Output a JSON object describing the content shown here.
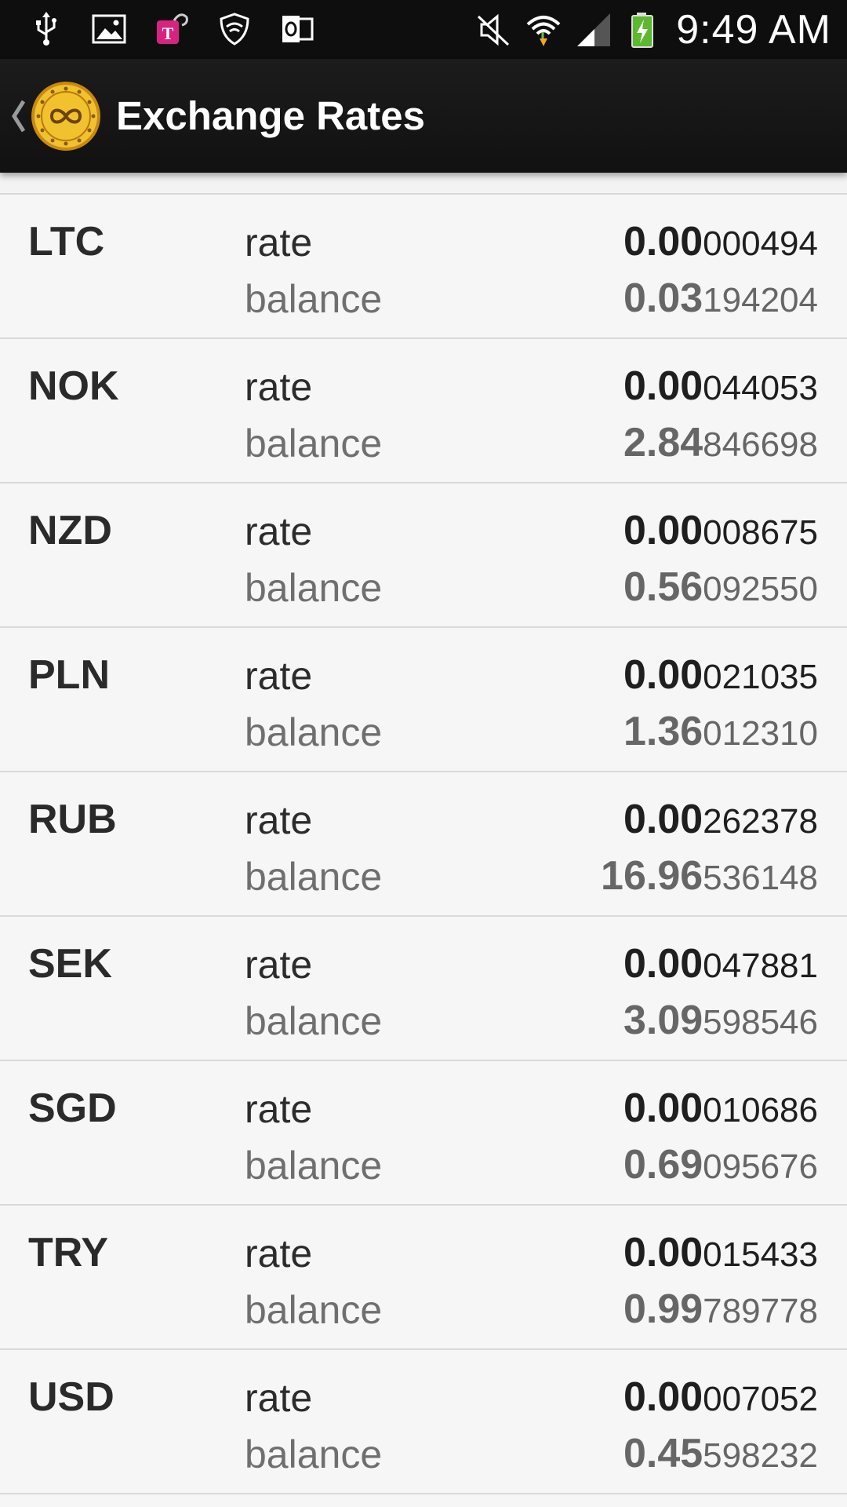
{
  "status_bar": {
    "time": "9:49 AM",
    "left_icons": [
      "usb-icon",
      "image-icon",
      "tmobile-icon",
      "shield-icon",
      "outlook-icon"
    ],
    "right_icons": [
      "mute-icon",
      "wifi-icon",
      "signal-icon",
      "battery-charging-icon"
    ]
  },
  "action_bar": {
    "title": "Exchange Rates",
    "logo_icon": "coin-logo-icon",
    "up_icon": "chevron-left-icon"
  },
  "colors": {
    "status_bg": "#0e0e0e",
    "actionbar_bg": "#161616",
    "list_bg": "#f6f6f6",
    "divider": "#d9d9d9",
    "logo_gold": "#e8b21c"
  },
  "labels": {
    "rate": "rate",
    "balance": "balance"
  },
  "rows": [
    {
      "currency": "LTC",
      "rate_major": "0.00",
      "rate_minor": "000494",
      "balance_major": "0.03",
      "balance_minor": "194204"
    },
    {
      "currency": "NOK",
      "rate_major": "0.00",
      "rate_minor": "044053",
      "balance_major": "2.84",
      "balance_minor": "846698"
    },
    {
      "currency": "NZD",
      "rate_major": "0.00",
      "rate_minor": "008675",
      "balance_major": "0.56",
      "balance_minor": "092550"
    },
    {
      "currency": "PLN",
      "rate_major": "0.00",
      "rate_minor": "021035",
      "balance_major": "1.36",
      "balance_minor": "012310"
    },
    {
      "currency": "RUB",
      "rate_major": "0.00",
      "rate_minor": "262378",
      "balance_major": "16.96",
      "balance_minor": "536148"
    },
    {
      "currency": "SEK",
      "rate_major": "0.00",
      "rate_minor": "047881",
      "balance_major": "3.09",
      "balance_minor": "598546"
    },
    {
      "currency": "SGD",
      "rate_major": "0.00",
      "rate_minor": "010686",
      "balance_major": "0.69",
      "balance_minor": "095676"
    },
    {
      "currency": "TRY",
      "rate_major": "0.00",
      "rate_minor": "015433",
      "balance_major": "0.99",
      "balance_minor": "789778"
    },
    {
      "currency": "USD",
      "rate_major": "0.00",
      "rate_minor": "007052",
      "balance_major": "0.45",
      "balance_minor": "598232"
    }
  ]
}
